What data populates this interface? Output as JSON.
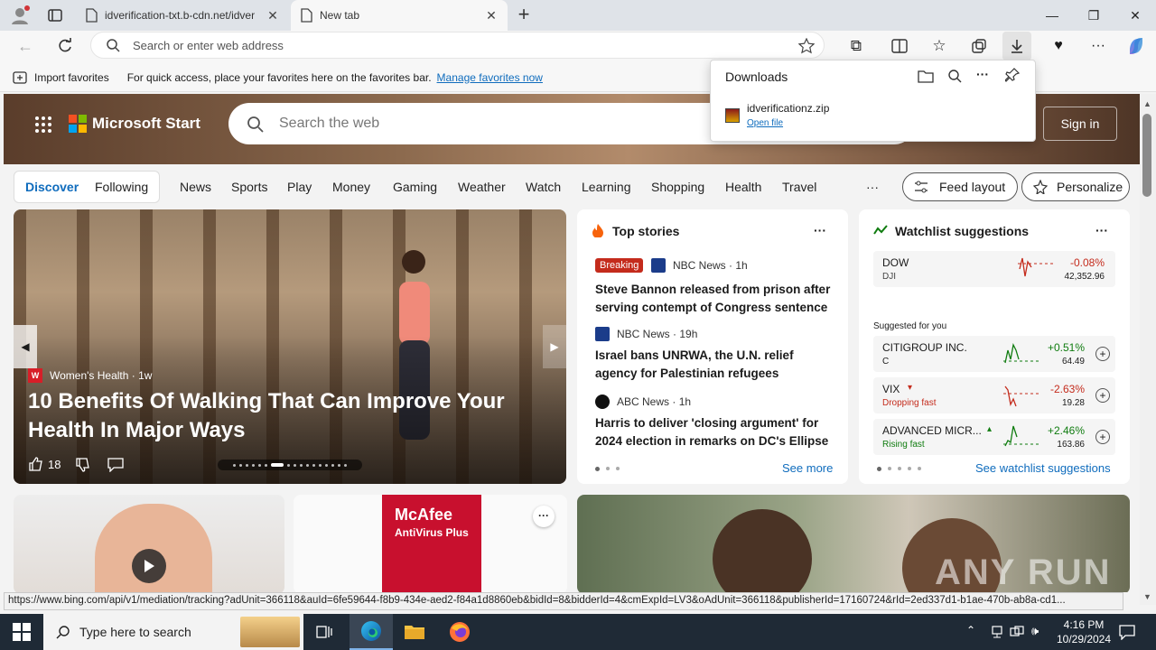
{
  "browser": {
    "tabs": [
      {
        "title": "idverification-txt.b-cdn.net/idver"
      },
      {
        "title": "New tab"
      }
    ],
    "address_placeholder": "Search or enter web address"
  },
  "favbar": {
    "import_label": "Import favorites",
    "hint": "For quick access, place your favorites here on the favorites bar.",
    "manage_link": "Manage favorites now"
  },
  "downloads": {
    "title": "Downloads",
    "file_name": "idverificationz.zip",
    "open_label": "Open file"
  },
  "msn": {
    "brand": "Microsoft Start",
    "search_placeholder": "Search the web",
    "sign_in": "Sign in",
    "pivots": [
      "Discover",
      "Following"
    ],
    "nav": [
      "News",
      "Sports",
      "Play",
      "Money",
      "Gaming",
      "Weather",
      "Watch",
      "Learning",
      "Shopping",
      "Health",
      "Travel"
    ],
    "more": "···",
    "feed_layout": "Feed layout",
    "personalize": "Personalize"
  },
  "hero_story": {
    "source": "Women's Health",
    "age": "1w",
    "headline": "10 Benefits Of Walking That Can Improve Your Health In Major Ways",
    "likes": "18"
  },
  "top_stories": {
    "title": "Top stories",
    "more_btn": "···",
    "items": [
      {
        "badge": "Breaking",
        "source": "NBC News",
        "age": "1h",
        "headline": "Steve Bannon released from prison after serving contempt of Congress sentence"
      },
      {
        "source": "NBC News",
        "age": "19h",
        "headline": "Israel bans UNRWA, the U.N. relief agency for Palestinian refugees"
      },
      {
        "source": "ABC News",
        "age": "1h",
        "headline": "Harris to deliver 'closing argument' for 2024 election in remarks on DC's Ellipse"
      }
    ],
    "see_more": "See more"
  },
  "watchlist": {
    "title": "Watchlist suggestions",
    "more_btn": "···",
    "main": {
      "name": "DOW",
      "symbol": "DJI",
      "change": "-0.08%",
      "price": "42,352.96"
    },
    "suggested_label": "Suggested for you",
    "items": [
      {
        "name": "CITIGROUP INC.",
        "sub": "C",
        "change": "+0.51%",
        "price": "64.49"
      },
      {
        "name": "VIX",
        "sub": "Dropping fast",
        "change": "-2.63%",
        "price": "19.28"
      },
      {
        "name": "ADVANCED MICR...",
        "sub": "Rising fast",
        "change": "+2.46%",
        "price": "163.86"
      }
    ],
    "see_all": "See watchlist suggestions"
  },
  "ad": {
    "brand": "McAfee",
    "product": "AntiVirus Plus"
  },
  "status_url": "https://www.bing.com/api/v1/mediation/tracking?adUnit=366118&auId=6fe59644-f8b9-434e-aed2-f84a1d8860eb&bidId=8&bidderId=4&cmExpId=LV3&oAdUnit=366118&publisherId=17160724&rId=2ed337d1-b1ae-470b-ab8a-cd1...",
  "watermark": "ANY RUN",
  "taskbar": {
    "search_placeholder": "Type here to search",
    "time": "4:16 PM",
    "date": "10/29/2024"
  },
  "colors": {
    "accent": "#0f6cbd",
    "positive": "#107c10",
    "negative": "#c42b1c",
    "taskbar": "#1f2a36"
  }
}
